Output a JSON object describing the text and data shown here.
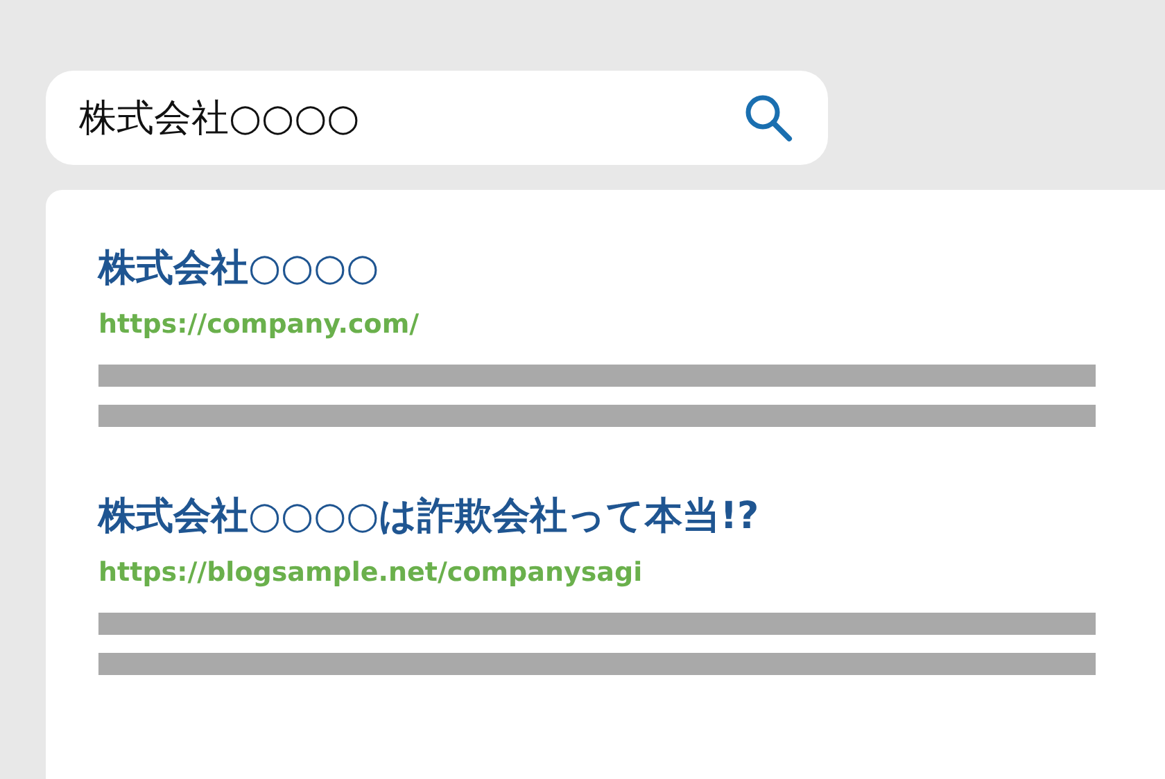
{
  "search": {
    "value": "株式会社○○○○"
  },
  "results": [
    {
      "title": "株式会社○○○○",
      "url": "https://company.com/"
    },
    {
      "title": "株式会社○○○○は詐欺会社って本当!?",
      "url": "https://blogsample.net/companysagi"
    }
  ]
}
